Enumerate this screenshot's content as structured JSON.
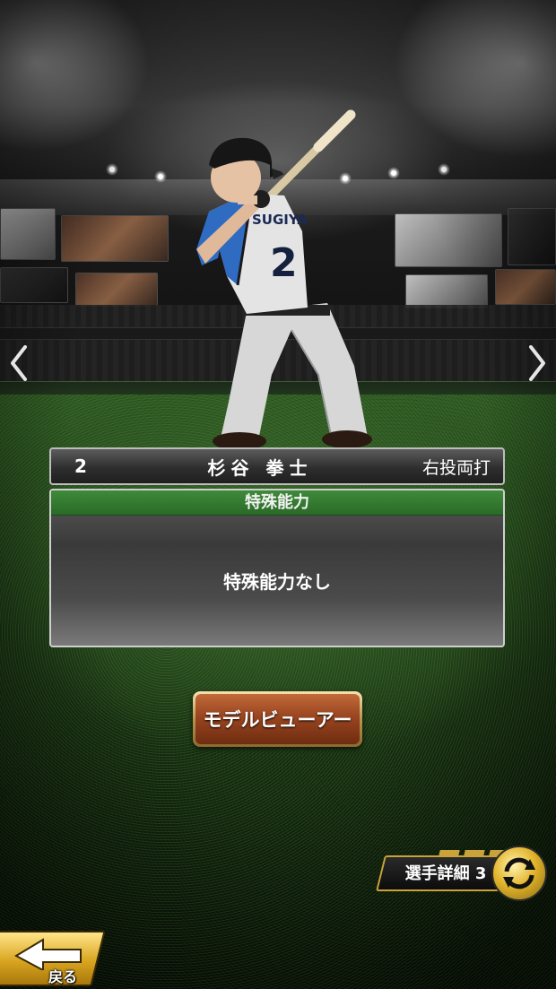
{
  "player": {
    "number": "2",
    "name": "杉谷 拳士",
    "handedness": "右投両打",
    "jersey_name": "SUGIYA",
    "jersey_number": "2"
  },
  "ability": {
    "header": "特殊能力",
    "body": "特殊能力なし"
  },
  "buttons": {
    "model_viewer": "モデルビューアー",
    "player_detail": "選手詳細 3",
    "back": "戻る"
  },
  "colors": {
    "ability_header_green": "#2f7a2c",
    "gold_accent": "#d9a520",
    "model_button_brown": "#9a4520"
  },
  "icons": {
    "nav_left": "chevron-left-icon",
    "nav_right": "chevron-right-icon",
    "detail": "swap-arrows-icon",
    "back": "back-arrow-icon"
  }
}
